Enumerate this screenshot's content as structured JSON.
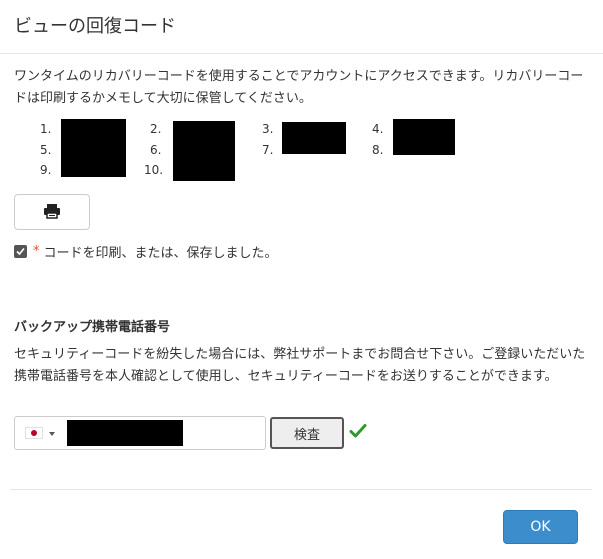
{
  "dialog": {
    "title": "ビューの回復コード",
    "intro": "ワンタイムのリカバリーコードを使用することでアカウントにアクセスできます。リカバリーコードは印刷するかメモして大切に保管してください。",
    "codes": [
      {
        "label": "1."
      },
      {
        "label": "2."
      },
      {
        "label": "3."
      },
      {
        "label": "4."
      },
      {
        "label": "5."
      },
      {
        "label": "6."
      },
      {
        "label": "7."
      },
      {
        "label": "8."
      },
      {
        "label": "9."
      },
      {
        "label": "10."
      }
    ],
    "print_icon": "printer-icon",
    "confirm": {
      "checked": true,
      "required_mark": "*",
      "label": "コードを印刷、または、保存しました。"
    },
    "backup": {
      "heading": "バックアップ携帯電話番号",
      "description": "セキュリティーコードを紛失した場合には、弊社サポートまでお問合せ下さい。ご登録いただいた携帯電話番号を本人確認として使用し、セキュリティーコードをお送りすることができます。",
      "country_icon": "japan-flag-icon",
      "verify_label": "検査",
      "verified_icon": "checkmark-icon"
    },
    "ok_label": "OK"
  },
  "colors": {
    "primary_button": "#3c8dcc",
    "success_check": "#2e9a2e",
    "required_mark": "#e74c3c",
    "redaction": "#000000"
  }
}
